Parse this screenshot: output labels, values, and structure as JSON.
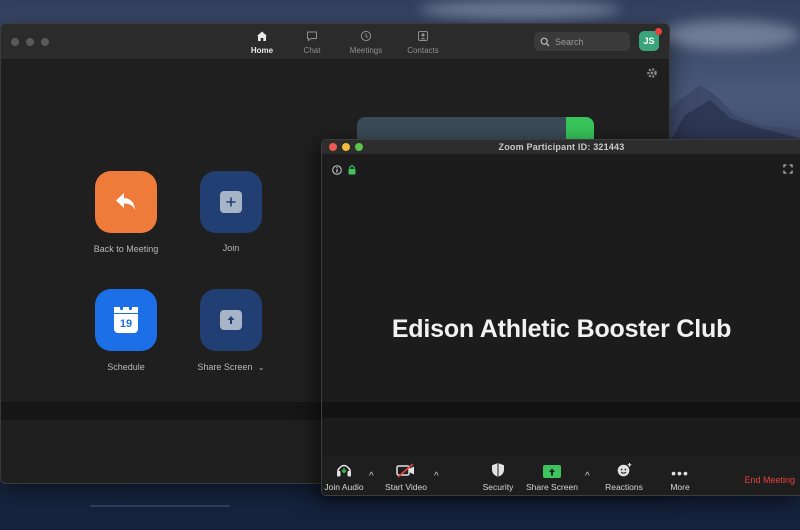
{
  "main_window": {
    "nav": [
      {
        "label": "Home",
        "icon": "home-icon",
        "active": true
      },
      {
        "label": "Chat",
        "icon": "chat-icon",
        "active": false
      },
      {
        "label": "Meetings",
        "icon": "clock-icon",
        "active": false
      },
      {
        "label": "Contacts",
        "icon": "contacts-icon",
        "active": false
      }
    ],
    "search": {
      "placeholder": "Search"
    },
    "avatar": {
      "initials": "JS",
      "color": "#3aa57a"
    },
    "tiles": [
      {
        "label": "Back to Meeting",
        "icon": "back-arrow-icon",
        "color": "#ef7b3a"
      },
      {
        "label": "Join",
        "icon": "plus-icon",
        "color": "#223f74"
      },
      {
        "label": "Schedule",
        "icon": "calendar-icon",
        "calendar_day": "19",
        "color": "#1d6fe8"
      },
      {
        "label": "Share Screen",
        "icon": "share-up-arrow-icon",
        "color": "#223f74"
      }
    ]
  },
  "meeting_window": {
    "title": "Zoom Participant ID: 321443",
    "meeting_name": "Edison Athletic Booster Club",
    "toolbar": {
      "join_audio": "Join Audio",
      "start_video": "Start Video",
      "security": "Security",
      "share_screen": "Share Screen",
      "reactions": "Reactions",
      "more": "More",
      "end_meeting": "End Meeting"
    },
    "colors": {
      "share_green": "#3dc45c",
      "end_red": "#e5423b"
    }
  }
}
